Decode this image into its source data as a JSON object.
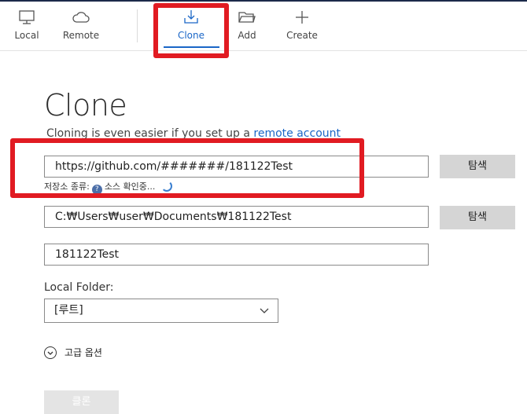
{
  "toolbar": {
    "items": [
      {
        "label": "Local",
        "icon": "monitor-icon"
      },
      {
        "label": "Remote",
        "icon": "cloud-icon"
      },
      {
        "label": "Clone",
        "icon": "download-icon"
      },
      {
        "label": "Add",
        "icon": "folder-icon"
      },
      {
        "label": "Create",
        "icon": "plus-icon"
      }
    ],
    "active_color": "#1a66c7"
  },
  "highlight_color": "#e11b22",
  "page": {
    "title": "Clone",
    "subtitle_text": "Cloning is even easier if you set up a ",
    "subtitle_link": "remote account"
  },
  "source": {
    "url": "https://github.com/#######/181122Test",
    "browse_label": "탐색",
    "status_prefix": "저장소 종류:",
    "status_icon_text": "?",
    "status_text": "소스 확인중..."
  },
  "destination": {
    "path": "C:₩Users₩user₩Documents₩181122Test",
    "browse_label": "탐색"
  },
  "name": {
    "value": "181122Test"
  },
  "local_folder": {
    "label": "Local Folder:",
    "selected": "[루트]"
  },
  "advanced": {
    "label": "고급 옵션"
  },
  "clone_button": {
    "label": "클론"
  }
}
